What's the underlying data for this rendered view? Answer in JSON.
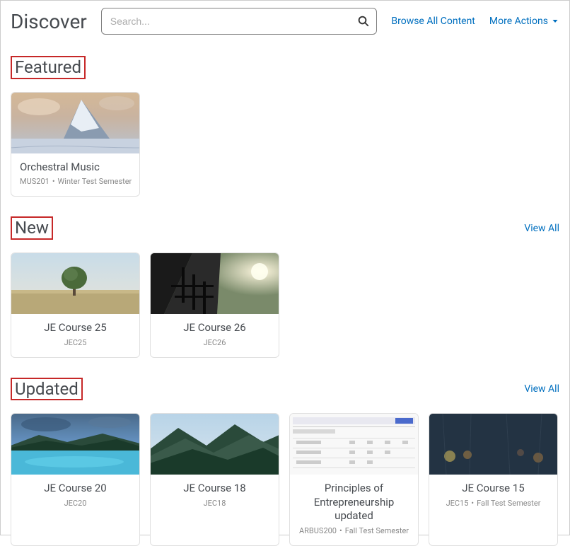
{
  "header": {
    "title": "Discover",
    "searchPlaceholder": "Search...",
    "browseLink": "Browse All Content",
    "moreActions": "More Actions"
  },
  "sections": {
    "featured": {
      "title": "Featured",
      "cards": [
        {
          "title": "Orchestral Music",
          "code": "MUS201",
          "term": "Winter Test Semester"
        }
      ]
    },
    "new": {
      "title": "New",
      "viewAll": "View All",
      "cards": [
        {
          "title": "JE Course 25",
          "code": "JEC25",
          "term": ""
        },
        {
          "title": "JE Course 26",
          "code": "JEC26",
          "term": ""
        }
      ]
    },
    "updated": {
      "title": "Updated",
      "viewAll": "View All",
      "cards": [
        {
          "title": "JE Course 20",
          "code": "JEC20",
          "term": ""
        },
        {
          "title": "JE Course 18",
          "code": "JEC18",
          "term": ""
        },
        {
          "title": "Principles of Entrepreneurship updated",
          "code": "ARBUS200",
          "term": "Fall Test Semester"
        },
        {
          "title": "JE Course 15",
          "code": "JEC15",
          "term": "Fall Test Semester"
        }
      ]
    }
  }
}
